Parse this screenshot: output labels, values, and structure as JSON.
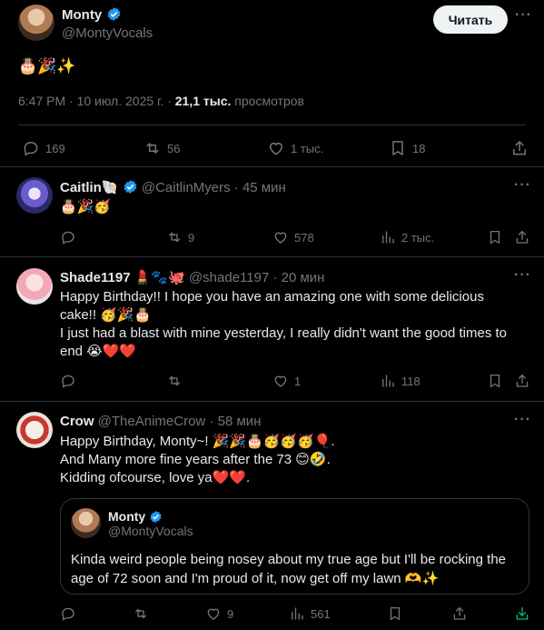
{
  "main_tweet": {
    "name": "Monty",
    "handle": "@MontyVocals",
    "follow_label": "Читать",
    "text": "🎂🎉✨",
    "time": "6:47 PM · 10 июл. 2025 г. ·",
    "views_count": "21,1 тыс.",
    "views_label": "просмотров",
    "replies": "169",
    "retweets": "56",
    "likes": "1 тыс.",
    "bookmarks": "18"
  },
  "replies": [
    {
      "name": "Caitlin",
      "name_emoji": "🐚",
      "handle": "@CaitlinMyers",
      "time": "· 45 мин",
      "text": "🎂🎉🥳",
      "retweets": "9",
      "likes": "578",
      "views": "2 тыс."
    },
    {
      "name": "Shade1197",
      "name_emoji": "💄🐾🐙",
      "handle": "@shade1197",
      "time": "· 20 мин",
      "line1": "Happy Birthday!! I hope you have an amazing one with some delicious",
      "line2": "cake!! 🥳🎉🎂",
      "line3": "I just had a blast with mine yesterday, I really didn't want the good times to",
      "line4": "end 😭❤️❤️",
      "likes": "1",
      "views": "118"
    },
    {
      "name": "Crow",
      "handle": "@TheAnimeCrow",
      "time": "· 58 мин",
      "line1": "Happy Birthday, Monty~! 🎉🎉🎂🥳🥳🥳🎈.",
      "line2": "And Many more fine years after the 73 😊🤣.",
      "line3": "Kidding ofcourse, love ya❤️❤️.",
      "quote": {
        "name": "Monty",
        "handle": "@MontyVocals",
        "line1": "Kinda weird people being nosey about my true age but I'll be rocking the",
        "line2": "age of 72 soon and I'm proud of it, now get off my lawn 🫶✨"
      },
      "likes": "9",
      "views": "561"
    }
  ],
  "colors": {
    "background": "#000000",
    "text": "#e7e9ea",
    "muted": "#71767b",
    "divider": "#2f3336",
    "verified": "#1d9bf0"
  }
}
